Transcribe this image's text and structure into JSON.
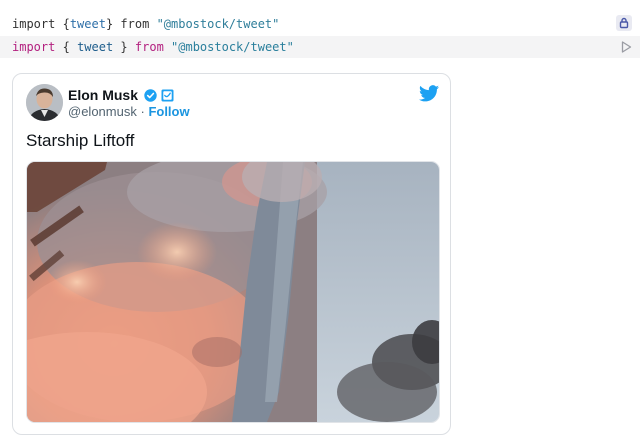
{
  "output": {
    "kw_import": "import",
    "brace_open": "{",
    "tweet": "tweet",
    "brace_close": "}",
    "kw_from": "from",
    "module": "\"@mbostock/tweet\""
  },
  "input": {
    "kw_import": "import",
    "brace_open": "{",
    "tweet": "tweet",
    "brace_close": "}",
    "kw_from": "from",
    "module": "\"@mbostock/tweet\""
  },
  "icons": {
    "lock": "lock-icon",
    "run": "play-icon",
    "verified": "verified-badge-icon",
    "translator": "translator-badge-icon",
    "twitter": "twitter-bird-icon"
  },
  "tweet": {
    "author_name": "Elon Musk",
    "handle": "@elonmusk",
    "separator": "·",
    "follow_label": "Follow",
    "text": "Starship Liftoff"
  },
  "colors": {
    "twitter_blue": "#1da1f2",
    "keyword": "#b3207f",
    "string": "#2a7f9c",
    "cell_background": "#f4f4f5"
  }
}
